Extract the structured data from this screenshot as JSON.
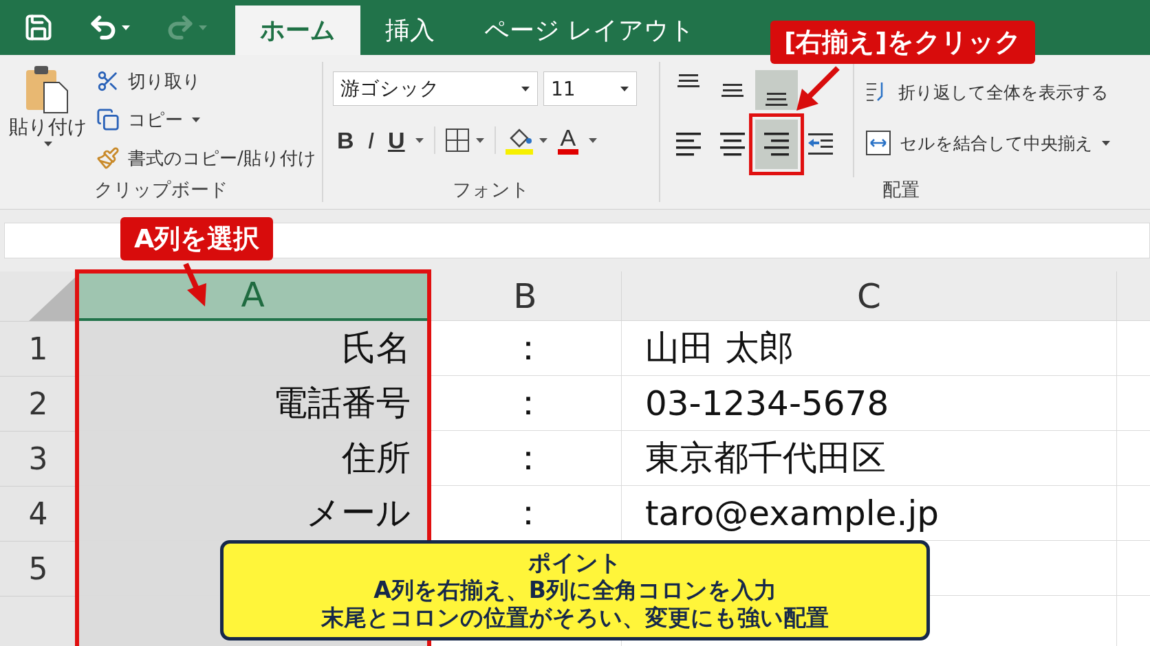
{
  "quick_access": [
    {
      "kind": "save",
      "disabled": false
    },
    {
      "kind": "undo",
      "disabled": false
    },
    {
      "kind": "redo",
      "disabled": true
    }
  ],
  "tabs": [
    {
      "label": "ホーム",
      "selected": true
    },
    {
      "label": "挿入",
      "selected": false
    },
    {
      "label": "ページ レイアウト",
      "selected": false
    }
  ],
  "ribbon": {
    "clipboard": {
      "paste": "貼り付け",
      "items": [
        {
          "kind": "cut",
          "label": "切り取り",
          "dropdown": false
        },
        {
          "kind": "copy",
          "label": "コピー",
          "dropdown": true
        },
        {
          "kind": "format",
          "label": "書式のコピー/貼り付け",
          "dropdown": false
        }
      ],
      "group_label": "クリップボード"
    },
    "font": {
      "font_name": "游ゴシック",
      "font_size": "11",
      "bold": "B",
      "italic": "I",
      "underline": "U",
      "font_color_letter": "A",
      "group_label": "フォント"
    },
    "alignment": {
      "rows": [
        [
          {
            "kind": "top",
            "selected": false,
            "outlined": false
          },
          {
            "kind": "middle",
            "selected": false,
            "outlined": false
          },
          {
            "kind": "bottom",
            "selected": true,
            "outlined": false
          }
        ],
        [
          {
            "kind": "left",
            "selected": false,
            "outlined": false
          },
          {
            "kind": "center",
            "selected": false,
            "outlined": false
          },
          {
            "kind": "right",
            "selected": true,
            "outlined": true
          },
          {
            "kind": "indent",
            "selected": false,
            "outlined": false
          }
        ]
      ],
      "wrap_text": "折り返して全体を表示する",
      "merge_center": "セルを結合して中央揃え",
      "group_label": "配置"
    }
  },
  "sheet": {
    "columns": [
      {
        "label": "A",
        "selected": true,
        "outlined": true
      },
      {
        "label": "B",
        "selected": false,
        "outlined": false
      },
      {
        "label": "C",
        "selected": false,
        "outlined": false
      }
    ],
    "rows": [
      {
        "number": "1",
        "cells": [
          "氏名",
          "：",
          "山田 太郎"
        ]
      },
      {
        "number": "2",
        "cells": [
          "電話番号",
          "：",
          "03-1234-5678"
        ]
      },
      {
        "number": "3",
        "cells": [
          "住所",
          "：",
          "東京都千代田区"
        ]
      },
      {
        "number": "4",
        "cells": [
          "メール",
          "：",
          "taro@example.jp"
        ]
      },
      {
        "number": "5"
      }
    ]
  },
  "callouts": [
    {
      "kind": "ribbon",
      "text": "[右揃え]をクリック"
    },
    {
      "kind": "column",
      "text": "A列を選択"
    }
  ],
  "point": {
    "title": "ポイント",
    "lines": [
      "A列を右揃え、B列に全角コロンを入力",
      "末尾とコロンの位置がそろい、変更にも強い配置"
    ]
  }
}
